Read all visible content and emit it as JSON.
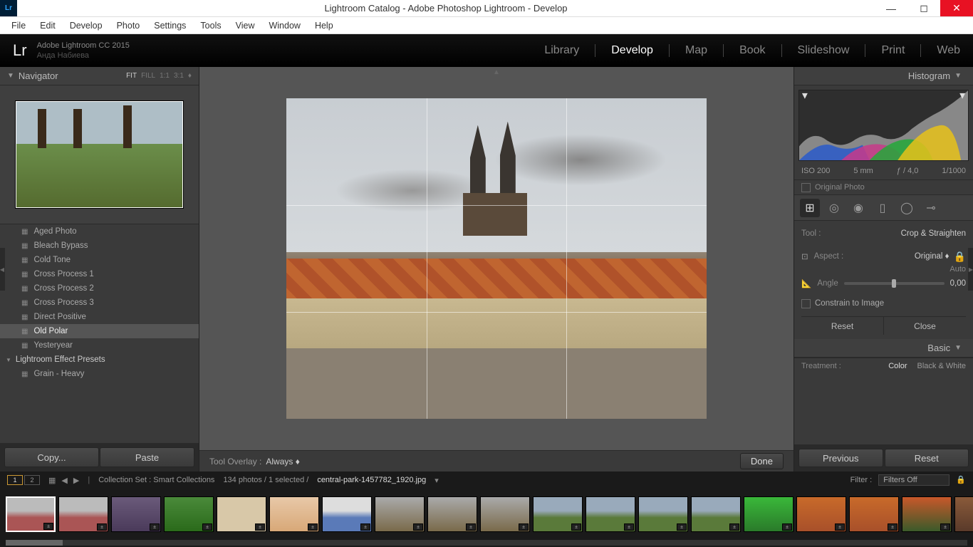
{
  "titlebar": {
    "logo": "Lr",
    "title": "Lightroom Catalog - Adobe Photoshop Lightroom - Develop"
  },
  "menu": [
    "File",
    "Edit",
    "Develop",
    "Photo",
    "Settings",
    "Tools",
    "View",
    "Window",
    "Help"
  ],
  "app_header": {
    "logo": "Lr",
    "product_line1": "Adobe Lightroom CC 2015",
    "product_line2": "Анда Набиева"
  },
  "modules": [
    "Library",
    "Develop",
    "Map",
    "Book",
    "Slideshow",
    "Print",
    "Web"
  ],
  "active_module": "Develop",
  "navigator": {
    "title": "Navigator",
    "zoom_levels": [
      "FIT",
      "FILL",
      "1:1",
      "3:1"
    ],
    "zoom_active": "FIT"
  },
  "presets": {
    "items": [
      "Aged Photo",
      "Bleach Bypass",
      "Cold Tone",
      "Cross Process 1",
      "Cross Process 2",
      "Cross Process 3",
      "Direct Positive",
      "Old Polar",
      "Yesteryear"
    ],
    "selected": "Old Polar",
    "group": "Lightroom Effect Presets",
    "sub": "Grain - Heavy"
  },
  "copy_paste": {
    "copy": "Copy...",
    "paste": "Paste"
  },
  "tool_overlay": {
    "label": "Tool Overlay :",
    "value": "Always",
    "done": "Done"
  },
  "histogram": {
    "title": "Histogram",
    "info": {
      "iso": "ISO 200",
      "focal": "5 mm",
      "aperture": "ƒ / 4,0",
      "shutter": "1/1000"
    },
    "original": "Original Photo"
  },
  "crop_tool": {
    "tool_label": "Tool :",
    "tool_value": "Crop & Straighten",
    "aspect_label": "Aspect :",
    "aspect_value": "Original",
    "auto": "Auto",
    "angle_label": "Angle",
    "angle_value": "0,00",
    "constrain": "Constrain to Image",
    "reset": "Reset",
    "close": "Close"
  },
  "basic": {
    "title": "Basic",
    "treatment_label": "Treatment :",
    "color": "Color",
    "bw": "Black & White"
  },
  "prev_reset": {
    "previous": "Previous",
    "reset": "Reset"
  },
  "info_bar": {
    "collection": "Collection Set : Smart Collections",
    "count": "134 photos / 1 selected /",
    "filename": "central-park-1457782_1920.jpg",
    "filter_label": "Filter :",
    "filter_value": "Filters Off"
  }
}
